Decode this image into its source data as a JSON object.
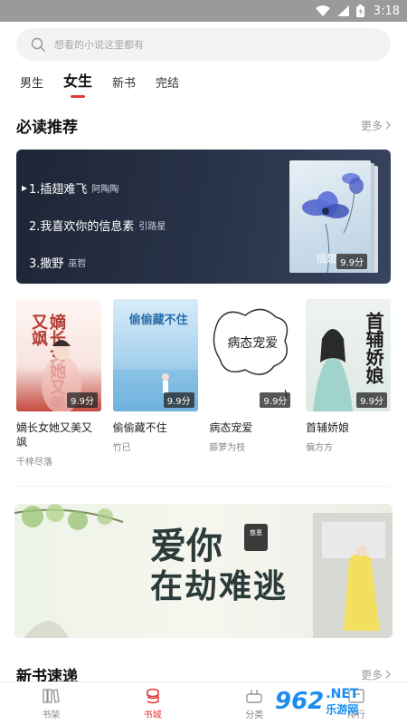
{
  "status_bar": {
    "time": "3:18"
  },
  "search": {
    "placeholder": "想看的小说这里都有"
  },
  "tabs": [
    {
      "label": "男生",
      "active": false
    },
    {
      "label": "女生",
      "active": true
    },
    {
      "label": "新书",
      "active": false
    },
    {
      "label": "完结",
      "active": false
    }
  ],
  "must_read": {
    "title": "必读推荐",
    "more": "更多",
    "ranking": [
      {
        "title": "1.插翅难飞",
        "author": "阿陶陶"
      },
      {
        "title": "2.我喜欢你的信息素",
        "author": "引路星"
      },
      {
        "title": "3.撒野",
        "author": "巫哲"
      }
    ],
    "featured_cover": {
      "caption": "插翅难飞",
      "score": "9.9分"
    }
  },
  "books": [
    {
      "title": "嫡长女她又美又飒",
      "author": "千梓尽落",
      "score": "9.9分",
      "cover_text": "嫡长女她又美又飒"
    },
    {
      "title": "偷偷藏不住",
      "author": "竹已",
      "score": "9.9分",
      "cover_text": "偷偷藏不住"
    },
    {
      "title": "病态宠爱",
      "author": "藤萝为枝",
      "score": "9.9分",
      "cover_text": "病态宠爱"
    },
    {
      "title": "首辅娇娘",
      "author": "偏方方",
      "score": "9.9分",
      "cover_text": "首辅娇娘"
    }
  ],
  "banner": {
    "line1": "爱你",
    "line2": "在劫难逃",
    "seal": "慈恩"
  },
  "new_books": {
    "title": "新书速递",
    "more": "更多"
  },
  "bottom_nav": [
    {
      "label": "书架",
      "icon": "bookshelf-icon",
      "active": false
    },
    {
      "label": "书城",
      "icon": "bookstore-icon",
      "active": true
    },
    {
      "label": "分类",
      "icon": "category-icon",
      "active": false
    },
    {
      "label": "排行",
      "icon": "ranking-icon",
      "active": false
    }
  ],
  "watermark": {
    "logo": "962",
    "net": ".NET",
    "cn": "乐游网"
  },
  "colors": {
    "accent": "#e53a3a",
    "status_bar": "#9a9a9a",
    "rank_card": "#232c3f"
  }
}
